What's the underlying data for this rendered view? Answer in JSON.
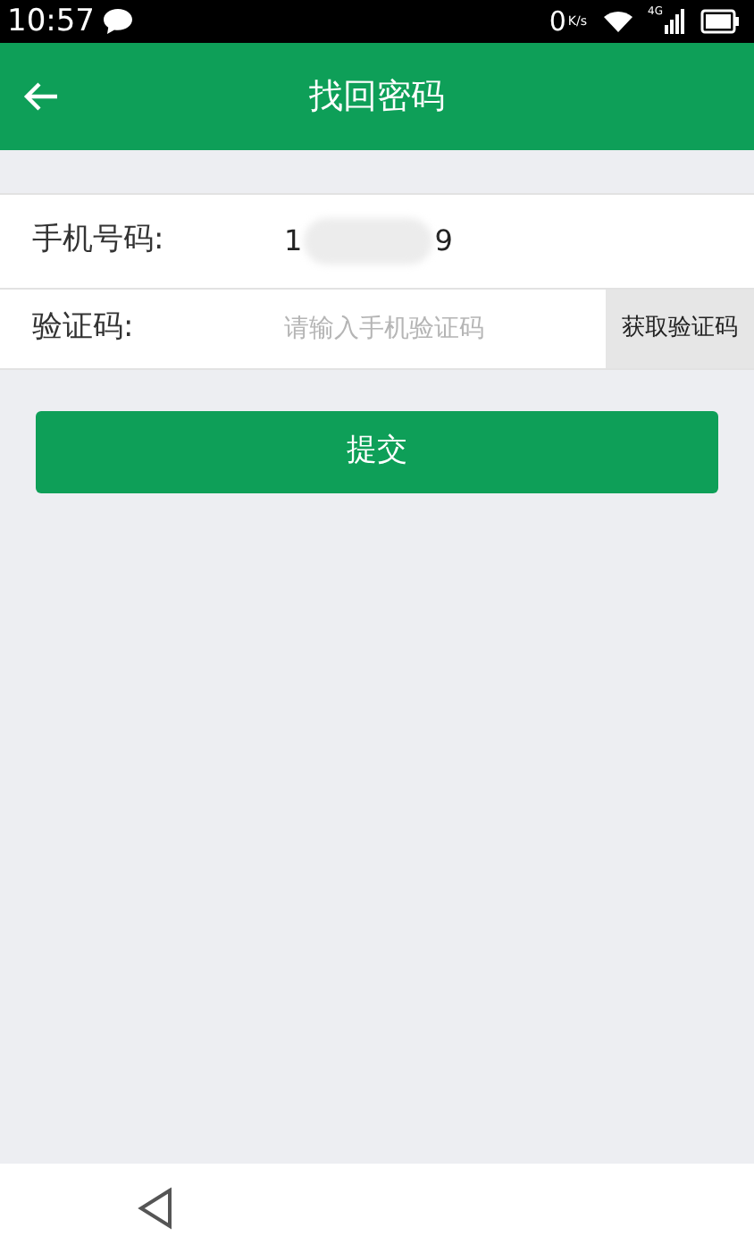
{
  "status_bar": {
    "time": "10:57",
    "speed_value": "0",
    "speed_unit": "K/s",
    "network": "4G"
  },
  "header": {
    "title": "找回密码"
  },
  "form": {
    "phone": {
      "label": "手机号码:",
      "value_start": "1",
      "value_end": "9"
    },
    "code": {
      "label": "验证码:",
      "placeholder": "请输入手机验证码",
      "button": "获取验证码"
    },
    "submit": "提交"
  }
}
